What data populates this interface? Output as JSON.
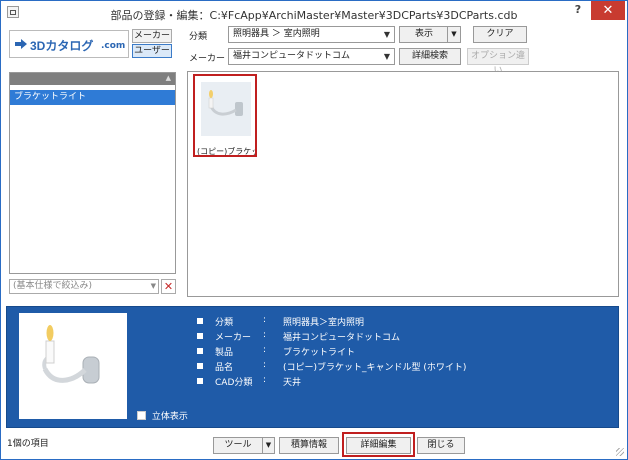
{
  "window": {
    "title": "部品の登録・編集：C:¥FcApp¥ArchiMaster¥Master¥3DCParts¥3DCParts.cdb",
    "help_label": "?",
    "close_label": "✕"
  },
  "logo": {
    "brand_text": "3Dカタログ",
    "domain_text": ".com"
  },
  "mode_buttons": {
    "maker": "メーカー",
    "user": "ユーザー"
  },
  "classification": {
    "label": "分類",
    "value": "照明器具 ＞ 室内照明"
  },
  "maker_filter": {
    "label": "メーカー",
    "value": "福井コンピュータドットコム"
  },
  "buttons": {
    "display": "表示",
    "clear": "クリア",
    "detail_search": "詳細検索",
    "option_diff": "オプション違い"
  },
  "left_list": {
    "items": [
      "ブラケットライト"
    ]
  },
  "filter": {
    "placeholder": "(基本仕様で絞込み)",
    "clear_label": "✕"
  },
  "grid_items": [
    {
      "caption": "(コピー)ブラケッ..."
    }
  ],
  "properties": [
    {
      "key": "分類",
      "value": "照明器具＞室内照明"
    },
    {
      "key": "メーカー",
      "value": "福井コンピュータドットコム"
    },
    {
      "key": "製品",
      "value": "ブラケットライト"
    },
    {
      "key": "品名",
      "value": "(コピー)ブラケット_キャンドル型 (ホワイト)"
    },
    {
      "key": "CAD分類",
      "value": "天井"
    }
  ],
  "separator": ":",
  "stereo_view_label": "立体表示",
  "status_text": "1個の項目",
  "footer": {
    "tools": "ツール",
    "accumulate": "積算情報",
    "detail_edit": "詳細編集",
    "close": "閉じる"
  },
  "colors": {
    "accent": "#2f7bd6",
    "detail_panel": "#1f5ba8",
    "highlight": "#c01f1f",
    "close_button": "#c83b30"
  }
}
